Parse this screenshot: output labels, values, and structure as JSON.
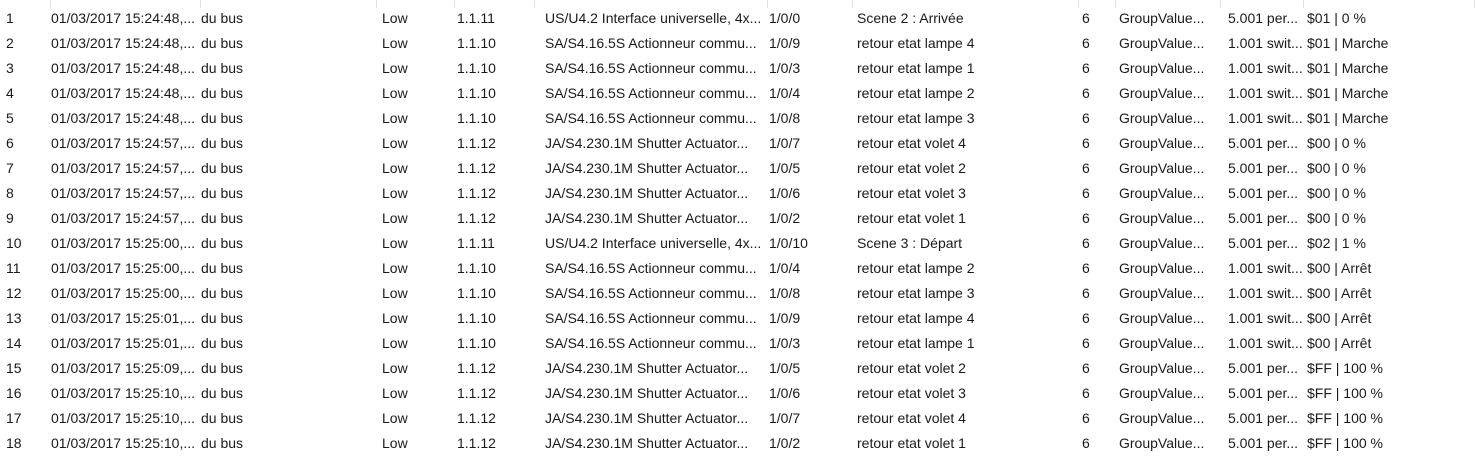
{
  "rows": [
    {
      "num": "1",
      "time": "01/03/2017 15:24:48,...",
      "service": "du bus",
      "priority": "Low",
      "source": "1.1.11",
      "device": "US/U4.2 Interface universelle, 4x...",
      "dest": "1/0/0",
      "dest_name": "Scene 2 : Arrivée",
      "rout": "6",
      "type": "GroupValue...",
      "dpt": "5.001 per...",
      "info": "$01 | 0 %"
    },
    {
      "num": "2",
      "time": "01/03/2017 15:24:48,...",
      "service": "du bus",
      "priority": "Low",
      "source": "1.1.10",
      "device": "SA/S4.16.5S Actionneur commu...",
      "dest": "1/0/9",
      "dest_name": "retour etat lampe 4",
      "rout": "6",
      "type": "GroupValue...",
      "dpt": "1.001 swit...",
      "info": "$01 | Marche"
    },
    {
      "num": "3",
      "time": "01/03/2017 15:24:48,...",
      "service": "du bus",
      "priority": "Low",
      "source": "1.1.10",
      "device": "SA/S4.16.5S Actionneur commu...",
      "dest": "1/0/3",
      "dest_name": "retour etat lampe 1",
      "rout": "6",
      "type": "GroupValue...",
      "dpt": "1.001 swit...",
      "info": "$01 | Marche"
    },
    {
      "num": "4",
      "time": "01/03/2017 15:24:48,...",
      "service": "du bus",
      "priority": "Low",
      "source": "1.1.10",
      "device": "SA/S4.16.5S Actionneur commu...",
      "dest": "1/0/4",
      "dest_name": "retour etat lampe 2",
      "rout": "6",
      "type": "GroupValue...",
      "dpt": "1.001 swit...",
      "info": "$01 | Marche"
    },
    {
      "num": "5",
      "time": "01/03/2017 15:24:48,...",
      "service": "du bus",
      "priority": "Low",
      "source": "1.1.10",
      "device": "SA/S4.16.5S Actionneur commu...",
      "dest": "1/0/8",
      "dest_name": "retour etat lampe 3",
      "rout": "6",
      "type": "GroupValue...",
      "dpt": "1.001 swit...",
      "info": "$01 | Marche"
    },
    {
      "num": "6",
      "time": "01/03/2017 15:24:57,...",
      "service": "du bus",
      "priority": "Low",
      "source": "1.1.12",
      "device": "JA/S4.230.1M Shutter Actuator...",
      "dest": "1/0/7",
      "dest_name": "retour etat volet 4",
      "rout": "6",
      "type": "GroupValue...",
      "dpt": "5.001 per...",
      "info": "$00 | 0 %"
    },
    {
      "num": "7",
      "time": "01/03/2017 15:24:57,...",
      "service": "du bus",
      "priority": "Low",
      "source": "1.1.12",
      "device": "JA/S4.230.1M Shutter Actuator...",
      "dest": "1/0/5",
      "dest_name": "retour etat volet 2",
      "rout": "6",
      "type": "GroupValue...",
      "dpt": "5.001 per...",
      "info": "$00 | 0 %"
    },
    {
      "num": "8",
      "time": "01/03/2017 15:24:57,...",
      "service": "du bus",
      "priority": "Low",
      "source": "1.1.12",
      "device": "JA/S4.230.1M Shutter Actuator...",
      "dest": "1/0/6",
      "dest_name": "retour etat volet 3",
      "rout": "6",
      "type": "GroupValue...",
      "dpt": "5.001 per...",
      "info": "$00 | 0 %"
    },
    {
      "num": "9",
      "time": "01/03/2017 15:24:57,...",
      "service": "du bus",
      "priority": "Low",
      "source": "1.1.12",
      "device": "JA/S4.230.1M Shutter Actuator...",
      "dest": "1/0/2",
      "dest_name": "retour etat volet 1",
      "rout": "6",
      "type": "GroupValue...",
      "dpt": "5.001 per...",
      "info": "$00 | 0 %"
    },
    {
      "num": "10",
      "time": "01/03/2017 15:25:00,...",
      "service": "du bus",
      "priority": "Low",
      "source": "1.1.11",
      "device": "US/U4.2 Interface universelle, 4x...",
      "dest": "1/0/10",
      "dest_name": "Scene 3 : Départ",
      "rout": "6",
      "type": "GroupValue...",
      "dpt": "5.001 per...",
      "info": "$02 | 1 %"
    },
    {
      "num": "11",
      "time": "01/03/2017 15:25:00,...",
      "service": "du bus",
      "priority": "Low",
      "source": "1.1.10",
      "device": "SA/S4.16.5S Actionneur commu...",
      "dest": "1/0/4",
      "dest_name": "retour etat lampe 2",
      "rout": "6",
      "type": "GroupValue...",
      "dpt": "1.001 swit...",
      "info": "$00 | Arrêt"
    },
    {
      "num": "12",
      "time": "01/03/2017 15:25:00,...",
      "service": "du bus",
      "priority": "Low",
      "source": "1.1.10",
      "device": "SA/S4.16.5S Actionneur commu...",
      "dest": "1/0/8",
      "dest_name": "retour etat lampe 3",
      "rout": "6",
      "type": "GroupValue...",
      "dpt": "1.001 swit...",
      "info": "$00 | Arrêt"
    },
    {
      "num": "13",
      "time": "01/03/2017 15:25:01,...",
      "service": "du bus",
      "priority": "Low",
      "source": "1.1.10",
      "device": "SA/S4.16.5S Actionneur commu...",
      "dest": "1/0/9",
      "dest_name": "retour etat lampe 4",
      "rout": "6",
      "type": "GroupValue...",
      "dpt": "1.001 swit...",
      "info": "$00 | Arrêt"
    },
    {
      "num": "14",
      "time": "01/03/2017 15:25:01,...",
      "service": "du bus",
      "priority": "Low",
      "source": "1.1.10",
      "device": "SA/S4.16.5S Actionneur commu...",
      "dest": "1/0/3",
      "dest_name": "retour etat lampe 1",
      "rout": "6",
      "type": "GroupValue...",
      "dpt": "1.001 swit...",
      "info": "$00 | Arrêt"
    },
    {
      "num": "15",
      "time": "01/03/2017 15:25:09,...",
      "service": "du bus",
      "priority": "Low",
      "source": "1.1.12",
      "device": "JA/S4.230.1M Shutter Actuator...",
      "dest": "1/0/5",
      "dest_name": "retour etat volet 2",
      "rout": "6",
      "type": "GroupValue...",
      "dpt": "5.001 per...",
      "info": "$FF | 100 %"
    },
    {
      "num": "16",
      "time": "01/03/2017 15:25:10,...",
      "service": "du bus",
      "priority": "Low",
      "source": "1.1.12",
      "device": "JA/S4.230.1M Shutter Actuator...",
      "dest": "1/0/6",
      "dest_name": "retour etat volet 3",
      "rout": "6",
      "type": "GroupValue...",
      "dpt": "5.001 per...",
      "info": "$FF | 100 %"
    },
    {
      "num": "17",
      "time": "01/03/2017 15:25:10,...",
      "service": "du bus",
      "priority": "Low",
      "source": "1.1.12",
      "device": "JA/S4.230.1M Shutter Actuator...",
      "dest": "1/0/7",
      "dest_name": "retour etat volet 4",
      "rout": "6",
      "type": "GroupValue...",
      "dpt": "5.001 per...",
      "info": "$FF | 100 %"
    },
    {
      "num": "18",
      "time": "01/03/2017 15:25:10,...",
      "service": "du bus",
      "priority": "Low",
      "source": "1.1.12",
      "device": "JA/S4.230.1M Shutter Actuator...",
      "dest": "1/0/2",
      "dest_name": "retour etat volet 1",
      "rout": "6",
      "type": "GroupValue...",
      "dpt": "5.001 per...",
      "info": "$FF | 100 %"
    }
  ]
}
